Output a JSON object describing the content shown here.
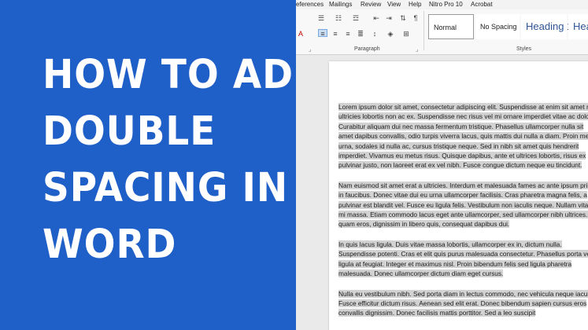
{
  "headline": {
    "lines": [
      "HOW TO ADD",
      "DOUBLE",
      "SPACING IN",
      "WORD"
    ]
  },
  "menu": [
    "eferences",
    "Mailings",
    "Review",
    "View",
    "Help",
    "Nitro Pro 10",
    "Acrobat"
  ],
  "ribbon": {
    "paragraph_group_label": "Paragraph",
    "styles_group_label": "Styles",
    "styles": [
      "Normal",
      "No Spacing",
      "Heading 1",
      "Hea"
    ]
  },
  "document": {
    "paragraphs": [
      "Lorem ipsum dolor sit amet, consectetur adipiscing elit. Suspendisse at enim sit amet nisl ultricies lobortis non ac ex. Suspendisse nec risus vel mi ornare imperdiet vitae ac dolor. Curabitur aliquam dui nec massa fermentum tristique. Phasellus ullamcorper nulla sit amet dapibus convallis, odio turpis viverra lacus, quis mattis dui nulla a diam. Proin metus urna, sodales id nulla ac, cursus tristique neque. Sed in nibh sit amet quis hendrerit imperdiet. Vivamus eu metus risus. Quisque dapibus, ante et ultrices lobortis, risus ex pulvinar justo, non laoreet erat ex vel nibh. Fusce congue dictum neque eu tincidunt.",
      "Nam euismod sit amet erat a ultricies. Interdum et malesuada fames ac ante ipsum primis in faucibus. Donec vitae dui eu urna ullamcorper facilisis. Cras pharetra magna felis, a pulvinar est blandit vel. Fusce eu ligula felis. Vestibulum non iaculis neque. Nullam vitae mi massa. Etiam commodo lacus eget ante ullamcorper, sed ullamcorper nibh ultrices. In quam eros, dignissim in libero quis, consequat dapibus dui.",
      "In quis lacus ligula. Duis vitae massa lobortis, ullamcorper ex in, dictum nulla. Suspendisse potenti. Cras et elit quis purus malesuada consectetur. Phasellus porta vel ligula at feugiat. Integer et maximus nisl. Proin bibendum felis sed ligula pharetra malesuada. Donec ullamcorper dictum diam eget cursus.",
      "Nulla eu vestibulum nibh. Sed porta diam in lectus commodo, nec vehicula neque iaculis. Fusce efficitur dictum risus. Aenean sed elit erat. Donec bibendum sapien cursus eros convallis dignissim. Donec facilisis mattis porttitor. Sed a leo suscipit"
    ]
  },
  "colors": {
    "left_panel": "#1f5fc8",
    "headline_text": "#ffffff",
    "selection_highlight": "#d2d2d2",
    "heading_style": "#2f5496"
  }
}
